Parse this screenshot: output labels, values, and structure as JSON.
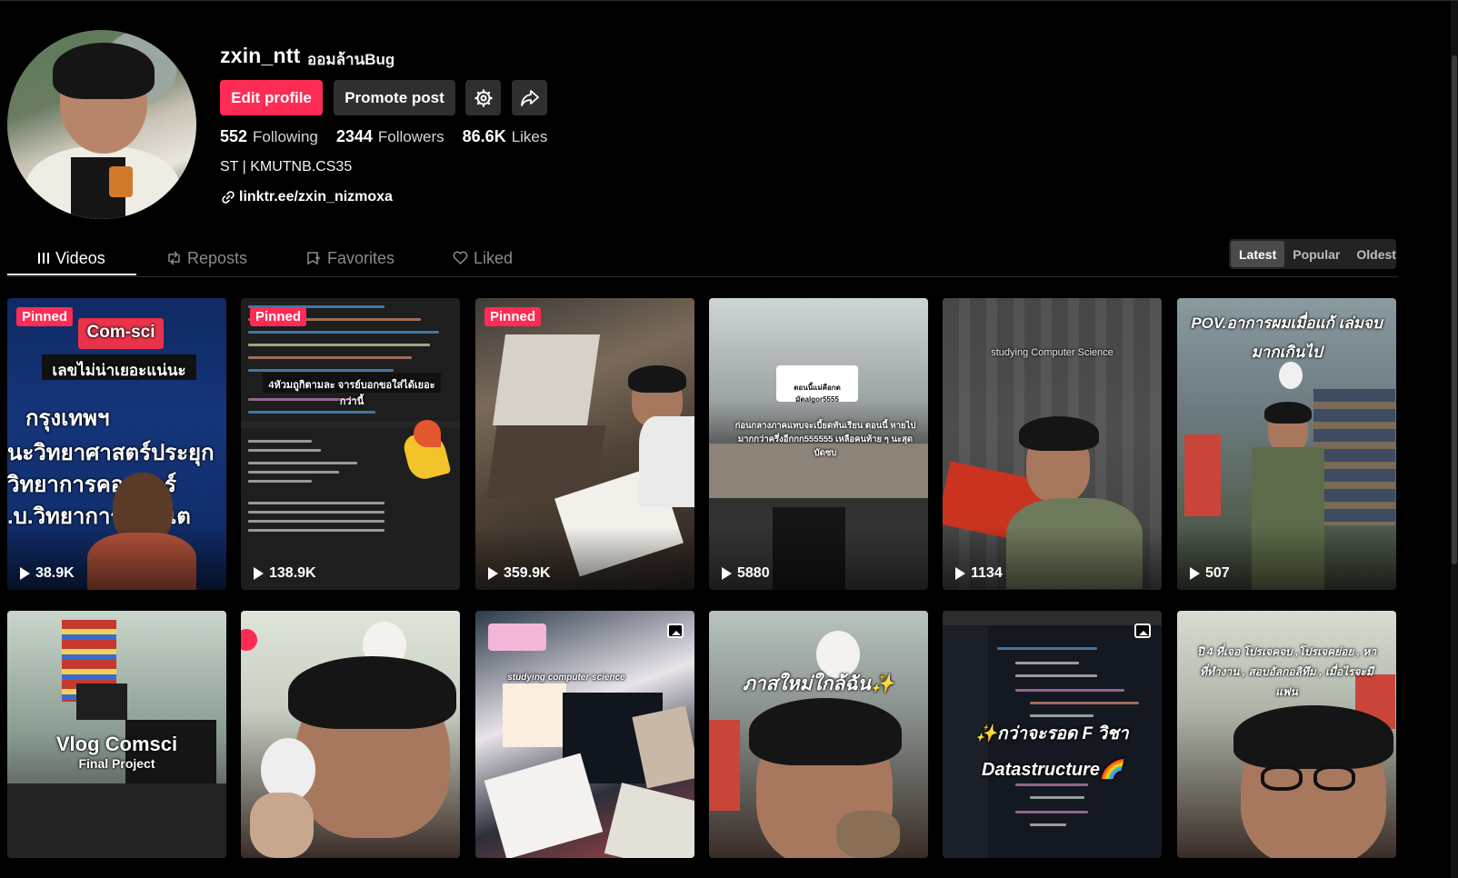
{
  "profile": {
    "username": "zxin_ntt",
    "nickname": "ออมล้านBug",
    "edit_label": "Edit profile",
    "promote_label": "Promote post",
    "following_count": "552",
    "following_label": "Following",
    "followers_count": "2344",
    "followers_label": "Followers",
    "likes_count": "86.6K",
    "likes_label": "Likes",
    "bio": "ST | KMUTNB.CS35",
    "link": "linktr.ee/zxin_nizmoxa"
  },
  "tabs": [
    {
      "label": "Videos",
      "icon": "grid-icon"
    },
    {
      "label": "Reposts",
      "icon": "repost-icon"
    },
    {
      "label": "Favorites",
      "icon": "bookmark-icon"
    },
    {
      "label": "Liked",
      "icon": "heart-icon"
    }
  ],
  "sort": [
    "Latest",
    "Popular",
    "Oldest"
  ],
  "videos": [
    {
      "pinned": "Pinned",
      "views": "38.9K",
      "overlay": "เลขไม่น่าเยอะแน่นะ",
      "tag": "Com-sci",
      "bg_lines": [
        "กรุงเทพฯ",
        "นะวิทยาศาสตร์ประยุก",
        "วิทยาการคอ เตอร์",
        ".บ.วิทยาการ มพิวเต"
      ]
    },
    {
      "pinned": "Pinned",
      "views": "138.9K",
      "overlay": "4หัวมถูกิตามละ จารย์บอกขอใส่ได้เยอะกว่านี้"
    },
    {
      "pinned": "Pinned",
      "views": "359.9K"
    },
    {
      "views": "5880",
      "overlay": "ก่อนกลางภาคแทบจะเบี้ยดทันเรียน ตอนนี้ หายไปมากกว่าครึ่งอีกกก555555 เหลือคนท้าย ๆ นะสุด บัดซบ",
      "note": "ตอนนี้แม่คือกดมัดalgor5555"
    },
    {
      "views": "1134",
      "overlay": "studying Computer Science"
    },
    {
      "views": "507",
      "overlay": "POV.อาการผมเมื่อแก้ เล่มจบมากเกินไป"
    },
    {
      "overlay": "Vlog Comsci",
      "sub": "Final Project"
    },
    {},
    {
      "overlay": "studying computer science"
    },
    {
      "overlay": "ภาสใหม่ใกล้ฉัน✨"
    },
    {
      "overlay": "✨กว่าจะรอด F วิชา",
      "sub": "Datastructure🌈"
    },
    {
      "overlay": "ปี 4 ที่เจอ โปรเจคจบ ,โปรเจคย่อย , หาที่ทำงาน , สอบอัลกอลิทึม , เมื่อไรจะมีแฟน"
    }
  ],
  "colors": {
    "accent": "#fe2c55",
    "button_dark": "#2f2f2f",
    "background": "#000000"
  }
}
